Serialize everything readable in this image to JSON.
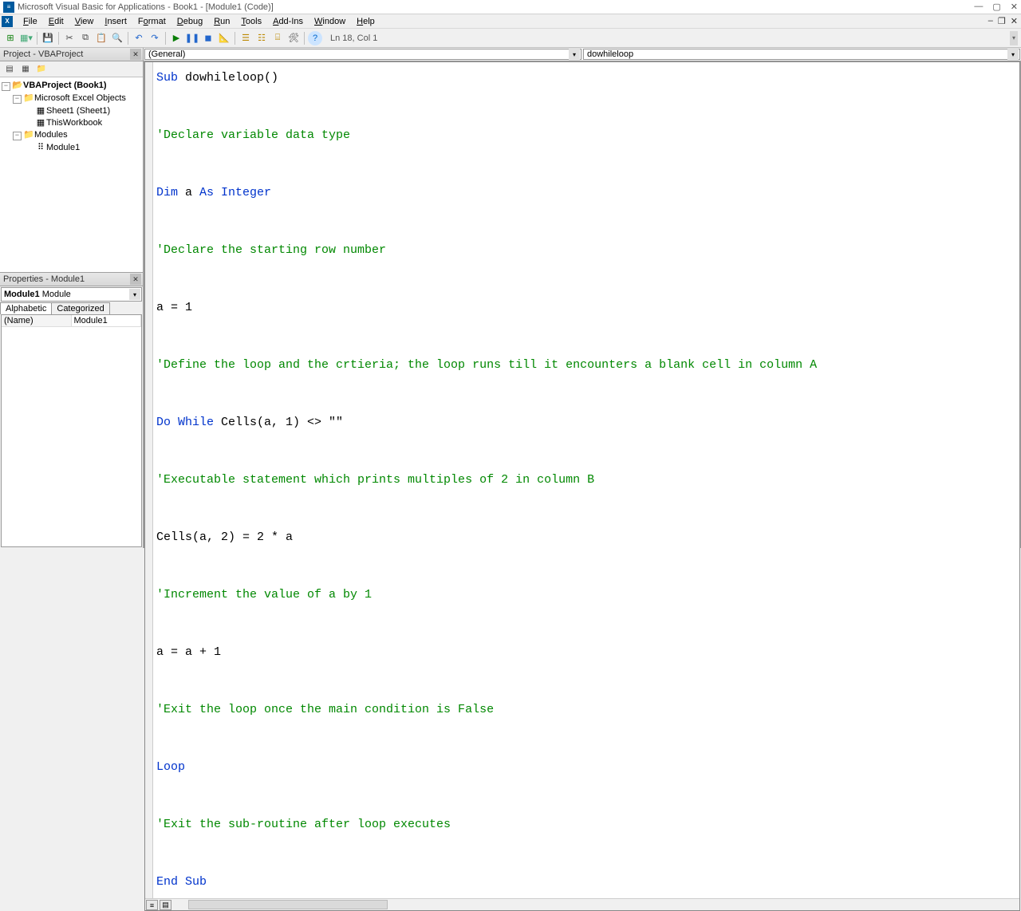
{
  "window": {
    "title": "Microsoft Visual Basic for Applications - Book1 - [Module1 (Code)]"
  },
  "menu": {
    "file": "File",
    "edit": "Edit",
    "view": "View",
    "insert": "Insert",
    "format": "Format",
    "debug": "Debug",
    "run": "Run",
    "tools": "Tools",
    "addins": "Add-Ins",
    "window": "Window",
    "help": "Help"
  },
  "toolbar": {
    "status": "Ln 18, Col 1"
  },
  "projectExplorer": {
    "title": "Project - VBAProject",
    "root": "VBAProject (Book1)",
    "excelObjects": "Microsoft Excel Objects",
    "sheet1": "Sheet1 (Sheet1)",
    "thisWorkbook": "ThisWorkbook",
    "modulesFolder": "Modules",
    "module1": "Module1"
  },
  "properties": {
    "title": "Properties - Module1",
    "objName": "Module1",
    "objType": "Module",
    "tabAlpha": "Alphabetic",
    "tabCat": "Categorized",
    "rowName": "(Name)",
    "rowVal": "Module1"
  },
  "codePane": {
    "leftDropdown": "(General)",
    "rightDropdown": "dowhileloop",
    "lines": [
      {
        "type": "code",
        "tokens": [
          {
            "t": "kw",
            "v": "Sub"
          },
          {
            "t": "tx",
            "v": " dowhileloop()"
          }
        ]
      },
      {
        "type": "blank"
      },
      {
        "type": "comment",
        "v": "'Declare variable data type"
      },
      {
        "type": "blank"
      },
      {
        "type": "code",
        "tokens": [
          {
            "t": "kw",
            "v": "Dim"
          },
          {
            "t": "tx",
            "v": " a "
          },
          {
            "t": "kw",
            "v": "As Integer"
          }
        ]
      },
      {
        "type": "blank"
      },
      {
        "type": "comment",
        "v": "'Declare the starting row number"
      },
      {
        "type": "blank"
      },
      {
        "type": "code",
        "tokens": [
          {
            "t": "tx",
            "v": "a = 1"
          }
        ]
      },
      {
        "type": "blank"
      },
      {
        "type": "comment",
        "v": "'Define the loop and the crtieria; the loop runs till it encounters a blank cell in column A"
      },
      {
        "type": "blank"
      },
      {
        "type": "code",
        "tokens": [
          {
            "t": "kw",
            "v": "Do While"
          },
          {
            "t": "tx",
            "v": " Cells(a, 1) <> \"\""
          }
        ]
      },
      {
        "type": "blank"
      },
      {
        "type": "comment",
        "v": "'Executable statement which prints multiples of 2 in column B"
      },
      {
        "type": "blank"
      },
      {
        "type": "code",
        "tokens": [
          {
            "t": "tx",
            "v": "Cells(a, 2) = 2 * a"
          }
        ]
      },
      {
        "type": "blank"
      },
      {
        "type": "comment",
        "v": "'Increment the value of a by 1"
      },
      {
        "type": "blank"
      },
      {
        "type": "code",
        "tokens": [
          {
            "t": "tx",
            "v": "a = a + 1"
          }
        ]
      },
      {
        "type": "blank"
      },
      {
        "type": "comment",
        "v": "'Exit the loop once the main condition is False"
      },
      {
        "type": "blank"
      },
      {
        "type": "code",
        "tokens": [
          {
            "t": "kw",
            "v": "Loop"
          }
        ]
      },
      {
        "type": "blank"
      },
      {
        "type": "comment",
        "v": "'Exit the sub-routine after loop executes"
      },
      {
        "type": "blank"
      },
      {
        "type": "code",
        "tokens": [
          {
            "t": "kw",
            "v": "End Sub"
          }
        ]
      }
    ]
  }
}
